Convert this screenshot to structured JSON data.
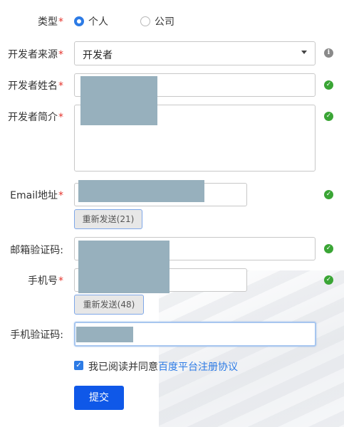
{
  "form": {
    "type": {
      "label": "类型",
      "required_mark": "*",
      "options": [
        "个人",
        "公司"
      ],
      "selected": "个人"
    },
    "source": {
      "label": "开发者来源",
      "required_mark": "*",
      "value": "开发者",
      "info_icon": "info-icon"
    },
    "name": {
      "label": "开发者姓名",
      "required_mark": "*",
      "status_icon": "check-circle-icon"
    },
    "intro": {
      "label": "开发者简介",
      "required_mark": "*",
      "status_icon": "check-circle-icon"
    },
    "email": {
      "label": "Email地址",
      "required_mark": "*",
      "resend_label": "重新发送(21)",
      "status_icon": "check-circle-icon"
    },
    "email_code": {
      "label": "邮箱验证码:",
      "status_icon": "check-circle-icon"
    },
    "phone": {
      "label": "手机号",
      "required_mark": "*",
      "resend_label": "重新发送(48)",
      "status_icon": "check-circle-icon"
    },
    "phone_code": {
      "label": "手机验证码:"
    },
    "agreement": {
      "checked": true,
      "text": "我已阅读并同意",
      "link_text": "百度平台注册协议"
    },
    "submit_label": "提交"
  },
  "colors": {
    "accent": "#2d7be5",
    "submit": "#0f58e8",
    "required": "#e5332c",
    "success": "#3aa535",
    "redacted": "#97b0bd"
  }
}
